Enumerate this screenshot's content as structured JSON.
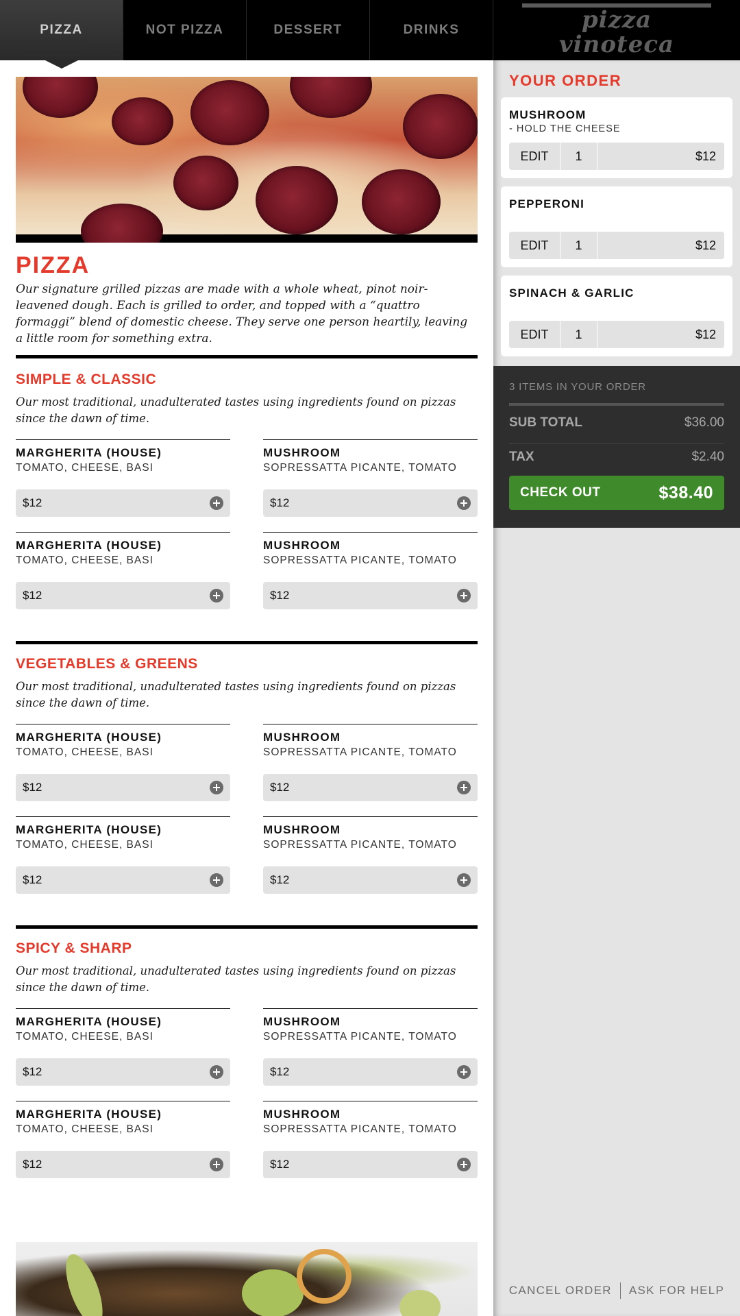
{
  "nav": {
    "tabs": [
      {
        "label": "PIZZA",
        "active": true
      },
      {
        "label": "NOT PIZZA",
        "active": false
      },
      {
        "label": "DESSERT",
        "active": false
      },
      {
        "label": "DRINKS",
        "active": false
      }
    ],
    "brand": "pizza vinoteca"
  },
  "menu": {
    "title": "PIZZA",
    "intro": "Our signature grilled pizzas are made with a whole wheat, pinot noir-leavened dough. Each is grilled to order, and topped with a “quattro formaggi” blend of domestic cheese. They serve one person heartily, leaving a little room for something extra.",
    "categories": [
      {
        "title": "SIMPLE & CLASSIC",
        "description": "Our most traditional, unadulterated tastes using ingredients found on pizzas since the dawn of time.",
        "items": [
          {
            "name": "MARGHERITA (HOUSE)",
            "ingredients": "TOMATO, CHEESE, BASI",
            "price": "$12"
          },
          {
            "name": "MUSHROOM",
            "ingredients": "SOPRESSATTA PICANTE, TOMATO",
            "price": "$12"
          },
          {
            "name": "MARGHERITA (HOUSE)",
            "ingredients": "TOMATO, CHEESE, BASI",
            "price": "$12"
          },
          {
            "name": "MUSHROOM",
            "ingredients": "SOPRESSATTA PICANTE, TOMATO",
            "price": "$12"
          }
        ]
      },
      {
        "title": "VEGETABLES & GREENS",
        "description": "Our most traditional, unadulterated tastes using ingredients found on pizzas since the dawn of time.",
        "items": [
          {
            "name": "MARGHERITA (HOUSE)",
            "ingredients": "TOMATO, CHEESE, BASI",
            "price": "$12"
          },
          {
            "name": "MUSHROOM",
            "ingredients": "SOPRESSATTA PICANTE, TOMATO",
            "price": "$12"
          },
          {
            "name": "MARGHERITA (HOUSE)",
            "ingredients": "TOMATO, CHEESE, BASI",
            "price": "$12"
          },
          {
            "name": "MUSHROOM",
            "ingredients": "SOPRESSATTA PICANTE, TOMATO",
            "price": "$12"
          }
        ]
      },
      {
        "title": "SPICY & SHARP",
        "description": "Our most traditional, unadulterated tastes using ingredients found on pizzas since the dawn of time.",
        "items": [
          {
            "name": "MARGHERITA (HOUSE)",
            "ingredients": "TOMATO, CHEESE, BASI",
            "price": "$12"
          },
          {
            "name": "MUSHROOM",
            "ingredients": "SOPRESSATTA PICANTE, TOMATO",
            "price": "$12"
          },
          {
            "name": "MARGHERITA (HOUSE)",
            "ingredients": "TOMATO, CHEESE, BASI",
            "price": "$12"
          },
          {
            "name": "MUSHROOM",
            "ingredients": "SOPRESSATTA PICANTE, TOMATO",
            "price": "$12"
          }
        ]
      }
    ]
  },
  "order": {
    "title": "YOUR ORDER",
    "items": [
      {
        "name": "MUSHROOM",
        "modifier": "- HOLD THE CHEESE",
        "edit_label": "EDIT",
        "qty": "1",
        "price": "$12"
      },
      {
        "name": "PEPPERONI",
        "modifier": "",
        "edit_label": "EDIT",
        "qty": "1",
        "price": "$12"
      },
      {
        "name": "SPINACH & GARLIC",
        "modifier": "",
        "edit_label": "EDIT",
        "qty": "1",
        "price": "$12"
      }
    ],
    "count_text": "3 ITEMS IN YOUR ORDER",
    "subtotal_label": "SUB TOTAL",
    "subtotal_value": "$36.00",
    "tax_label": "TAX",
    "tax_value": "$2.40",
    "checkout_label": "CHECK OUT",
    "checkout_total": "$38.40"
  },
  "footer": {
    "cancel_label": "CANCEL ORDER",
    "help_label": "ASK FOR HELP"
  },
  "colors": {
    "accent": "#e43a2b",
    "checkout": "#3f8a2a",
    "nav_bg": "#000000",
    "sidebar_bg": "#e4e4e4",
    "summary_bg": "#2e2e2e"
  },
  "icons": {
    "add_item": "plus-circle-icon"
  }
}
